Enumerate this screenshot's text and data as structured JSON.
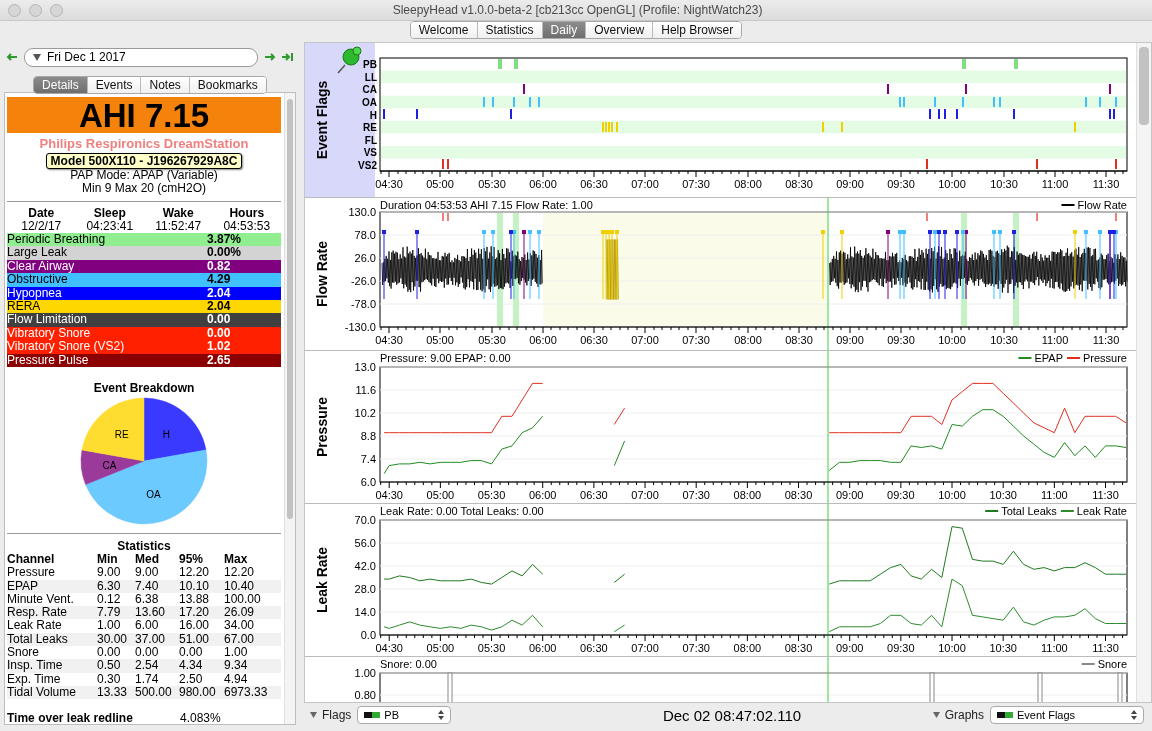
{
  "window": {
    "title": "SleepyHead v1.0.0-beta-2 [cb213cc OpenGL] (Profile: NightWatch23)"
  },
  "tabs": [
    {
      "label": "Welcome",
      "selected": false
    },
    {
      "label": "Statistics",
      "selected": false
    },
    {
      "label": "Daily",
      "selected": true
    },
    {
      "label": "Overview",
      "selected": false
    },
    {
      "label": "Help Browser",
      "selected": false
    }
  ],
  "date_nav": {
    "date": "Fri Dec 1 2017"
  },
  "side_tabs": [
    {
      "label": "Details",
      "selected": true
    },
    {
      "label": "Events",
      "selected": false
    },
    {
      "label": "Notes",
      "selected": false
    },
    {
      "label": "Bookmarks",
      "selected": false
    }
  ],
  "summary": {
    "ahi": "AHI 7.15",
    "machine": "Philips Respironics DreamStation",
    "tooltip": "Model 500X110 - J196267929A8C",
    "mode": "PAP Mode: APAP (Variable)",
    "pressure_range": "Min 9 Max 20 (cmH2O)"
  },
  "session": {
    "columns": [
      "Date",
      "Sleep",
      "Wake",
      "Hours"
    ],
    "values": [
      "12/2/17",
      "04:23:41",
      "11:52:47",
      "04:53:53"
    ]
  },
  "event_indices": [
    {
      "name": "Periodic Breathing",
      "value": "3.87%",
      "color": "#90ee90"
    },
    {
      "name": "Large Leak",
      "value": "0.00%",
      "color": "#d3d3d3"
    },
    {
      "name": "Clear Airway",
      "value": "0.82",
      "color": "#800080"
    },
    {
      "name": "Obstructive",
      "value": "4.29",
      "color": "#40c0ff"
    },
    {
      "name": "Hypopnea",
      "value": "2.04",
      "color": "#0000ff"
    },
    {
      "name": "RERA",
      "value": "2.04",
      "color": "#ffd700"
    },
    {
      "name": "Flow Limitation",
      "value": "0.00",
      "color": "#404040"
    },
    {
      "name": "Vibratory Snore",
      "value": "0.00",
      "color": "#ff2000"
    },
    {
      "name": "Vibratory Snore (VS2)",
      "value": "1.02",
      "color": "#ff2000"
    },
    {
      "name": "Pressure Pulse",
      "value": "2.65",
      "color": "#8b0000"
    }
  ],
  "event_breakdown": {
    "chart_data": {
      "type": "pie",
      "title": "Event Breakdown",
      "categories": [
        "H",
        "OA",
        "CA",
        "RE"
      ],
      "values": [
        22.2,
        46.7,
        8.9,
        22.2
      ],
      "colors": [
        "#3a3aff",
        "#6ccaff",
        "#9a3a9a",
        "#ffdc30"
      ]
    }
  },
  "statistics": {
    "title": "Statistics",
    "columns": [
      "Channel",
      "Min",
      "Med",
      "95%",
      "Max"
    ],
    "rows": [
      [
        "Pressure",
        "9.00",
        "9.00",
        "12.20",
        "12.20"
      ],
      [
        "EPAP",
        "6.30",
        "7.40",
        "10.10",
        "10.40"
      ],
      [
        "Minute Vent.",
        "0.12",
        "6.38",
        "13.88",
        "100.00"
      ],
      [
        "Resp. Rate",
        "7.79",
        "13.60",
        "17.20",
        "26.09"
      ],
      [
        "Leak Rate",
        "1.00",
        "6.00",
        "16.00",
        "34.00"
      ],
      [
        "Total Leaks",
        "30.00",
        "37.00",
        "51.00",
        "67.00"
      ],
      [
        "Snore",
        "0.00",
        "0.00",
        "0.00",
        "1.00"
      ],
      [
        "Insp. Time",
        "0.50",
        "2.54",
        "4.34",
        "9.34"
      ],
      [
        "Exp. Time",
        "0.30",
        "1.74",
        "2.50",
        "4.94"
      ],
      [
        "Tidal Volume",
        "13.33",
        "500.00",
        "980.00",
        "6973.33"
      ]
    ]
  },
  "leak_redline": {
    "label": "Time over leak redline",
    "value": "4.083%"
  },
  "graphs": [
    {
      "kind": "flags",
      "ylabel": "Event Flags",
      "rows": [
        {
          "label": "PB",
          "color": "#80e080"
        },
        {
          "label": "LL"
        },
        {
          "label": "CA",
          "color": "#800080"
        },
        {
          "label": "OA",
          "color": "#40c0ff"
        },
        {
          "label": "H",
          "color": "#2020e0"
        },
        {
          "label": "RE",
          "color": "#f0d000"
        },
        {
          "label": "FL"
        },
        {
          "label": "VS"
        },
        {
          "label": "VS2",
          "color": "#e03020"
        }
      ],
      "xticks": [
        "04:30",
        "05:00",
        "05:30",
        "06:00",
        "06:30",
        "07:00",
        "07:30",
        "08:00",
        "08:30",
        "09:00",
        "09:30",
        "10:00",
        "10:30",
        "11:00",
        "11:30"
      ]
    },
    {
      "kind": "wave",
      "ylabel": "Flow Rate",
      "header": "Duration 04:53:53 AHI 7.15 Flow Rate: 1.00",
      "legend": [
        {
          "name": "Flow Rate",
          "color": "#000000"
        }
      ],
      "yticks": [
        "130.0",
        "78.0",
        "26.0",
        "-26.0",
        "-78.0",
        "-130.0"
      ],
      "xticks": [
        "04:30",
        "05:00",
        "05:30",
        "06:00",
        "06:30",
        "07:00",
        "07:30",
        "08:00",
        "08:30",
        "09:00",
        "09:30",
        "10:00",
        "10:30",
        "11:00",
        "11:30"
      ]
    },
    {
      "kind": "line",
      "header": "Pressure: 9.00 EPAP: 0.00",
      "chart_data": {
        "type": "line",
        "ylabel": "Pressure",
        "grid": true,
        "legend": "upper right",
        "xlim": [
          4.41,
          11.71
        ],
        "ylim": [
          6,
          13
        ],
        "ref_lines": [
          {
            "axis": "x",
            "value": 8.784,
            "color": "#3fd03f"
          }
        ],
        "xticks": [
          {
            "value": 4.5,
            "label": "04:30"
          },
          {
            "value": 5,
            "label": "05:00"
          },
          {
            "value": 5.5,
            "label": "05:30"
          },
          {
            "value": 6,
            "label": "06:00"
          },
          {
            "value": 6.5,
            "label": "06:30"
          },
          {
            "value": 7,
            "label": "07:00"
          },
          {
            "value": 7.5,
            "label": "07:30"
          },
          {
            "value": 8,
            "label": "08:00"
          },
          {
            "value": 8.5,
            "label": "08:30"
          },
          {
            "value": 9,
            "label": "09:00"
          },
          {
            "value": 9.5,
            "label": "09:30"
          },
          {
            "value": 10,
            "label": "10:00"
          },
          {
            "value": 10.5,
            "label": "10:30"
          },
          {
            "value": 11,
            "label": "11:00"
          },
          {
            "value": 11.5,
            "label": "11:30"
          }
        ],
        "yticks": [
          {
            "value": 6,
            "label": "6.0"
          },
          {
            "value": 7.4,
            "label": "7.4"
          },
          {
            "value": 8.8,
            "label": "8.8"
          },
          {
            "value": 10.2,
            "label": "10.2"
          },
          {
            "value": 11.6,
            "label": "11.6"
          },
          {
            "value": 13,
            "label": "13.0"
          }
        ],
        "x": [
          4.45,
          4.5,
          4.6,
          4.7,
          4.8,
          4.9,
          5.0,
          5.1,
          5.2,
          5.3,
          5.4,
          5.5,
          5.6,
          5.7,
          5.8,
          5.9,
          6.0,
          6.7,
          6.8,
          8.8,
          8.9,
          9.0,
          9.1,
          9.2,
          9.3,
          9.4,
          9.5,
          9.6,
          9.7,
          9.8,
          9.9,
          10.0,
          10.1,
          10.2,
          10.3,
          10.4,
          10.5,
          10.6,
          10.7,
          10.8,
          10.9,
          11.0,
          11.1,
          11.2,
          11.3,
          11.4,
          11.5,
          11.6,
          11.7
        ],
        "series": [
          {
            "name": "EPAP",
            "color": "#228b22",
            "values": [
              6.5,
              7.0,
              7.1,
              7.1,
              7.2,
              7.1,
              7.2,
              7.2,
              7.2,
              7.3,
              7.3,
              7.1,
              8.0,
              8.2,
              9.0,
              9.3,
              10.0,
              7.0,
              8.5,
              6.7,
              7.2,
              7.2,
              7.3,
              7.3,
              7.3,
              7.2,
              7.2,
              8.2,
              8.1,
              8.2,
              8.0,
              9.5,
              9.4,
              10.0,
              10.4,
              10.4,
              10.0,
              9.4,
              8.8,
              8.3,
              7.8,
              7.5,
              8.4,
              7.6,
              8.2,
              7.5,
              8.2,
              8.2,
              8.1
            ]
          },
          {
            "name": "Pressure",
            "color": "#e03020",
            "values": [
              9,
              9,
              9,
              9,
              9,
              9,
              9,
              9,
              9,
              9,
              9,
              9,
              10,
              10,
              11,
              12,
              12,
              9.5,
              10.5,
              9,
              9,
              9,
              9,
              9,
              9,
              9,
              9,
              10,
              10,
              10,
              9.5,
              11,
              11.5,
              12,
              12,
              12,
              11.4,
              10.8,
              10.2,
              9.6,
              9.3,
              9,
              10.5,
              9,
              10,
              10,
              10,
              10,
              9.6
            ]
          }
        ]
      }
    },
    {
      "kind": "line",
      "header": "Leak Rate: 0.00 Total Leaks: 0.00",
      "chart_data": {
        "type": "line",
        "ylabel": "Leak Rate",
        "grid": true,
        "legend": "upper right",
        "xlim": [
          4.41,
          11.71
        ],
        "ylim": [
          0,
          70
        ],
        "ref_lines": [
          {
            "axis": "x",
            "value": 8.784,
            "color": "#3fd03f"
          }
        ],
        "xticks": [
          {
            "value": 4.5,
            "label": "04:30"
          },
          {
            "value": 5,
            "label": "05:00"
          },
          {
            "value": 5.5,
            "label": "05:30"
          },
          {
            "value": 6,
            "label": "06:00"
          },
          {
            "value": 6.5,
            "label": "06:30"
          },
          {
            "value": 7,
            "label": "07:00"
          },
          {
            "value": 7.5,
            "label": "07:30"
          },
          {
            "value": 8,
            "label": "08:00"
          },
          {
            "value": 8.5,
            "label": "08:30"
          },
          {
            "value": 9,
            "label": "09:00"
          },
          {
            "value": 9.5,
            "label": "09:30"
          },
          {
            "value": 10,
            "label": "10:00"
          },
          {
            "value": 10.5,
            "label": "10:30"
          },
          {
            "value": 11,
            "label": "11:00"
          },
          {
            "value": 11.5,
            "label": "11:30"
          }
        ],
        "yticks": [
          {
            "value": 0,
            "label": "0.0"
          },
          {
            "value": 14,
            "label": "14.0"
          },
          {
            "value": 28,
            "label": "28.0"
          },
          {
            "value": 42,
            "label": "42.0"
          },
          {
            "value": 56,
            "label": "56.0"
          },
          {
            "value": 70,
            "label": "70.0"
          }
        ],
        "x": [
          4.45,
          4.5,
          4.6,
          4.7,
          4.8,
          4.9,
          5.0,
          5.1,
          5.2,
          5.3,
          5.4,
          5.5,
          5.6,
          5.7,
          5.8,
          5.9,
          6.0,
          6.7,
          6.8,
          8.8,
          8.9,
          9.0,
          9.1,
          9.2,
          9.3,
          9.4,
          9.5,
          9.6,
          9.7,
          9.8,
          9.9,
          10.0,
          10.1,
          10.2,
          10.3,
          10.4,
          10.5,
          10.6,
          10.7,
          10.8,
          10.9,
          11.0,
          11.1,
          11.2,
          11.3,
          11.4,
          11.5,
          11.6,
          11.7
        ],
        "series": [
          {
            "name": "Total Leaks",
            "color": "#1e7a1e",
            "values": [
              34,
              34,
              36,
              35,
              33,
              34,
              33,
              33,
              33,
              34,
              32,
              31,
              35,
              39,
              36,
              43,
              37,
              32,
              37,
              31,
              33,
              33,
              33,
              33,
              37,
              41,
              43,
              36,
              34,
              40,
              35,
              66,
              65,
              46,
              45,
              45,
              43,
              51,
              43,
              40,
              41,
              39,
              41,
              41,
              44,
              41,
              37,
              37,
              37
            ]
          },
          {
            "name": "Leak Rate",
            "color": "#2e8b2e",
            "values": [
              5,
              4,
              6,
              8,
              6,
              5,
              4,
              5,
              4,
              6,
              5,
              3,
              5,
              9,
              6,
              12,
              5,
              2,
              6,
              2,
              5,
              5,
              5,
              5,
              7,
              12,
              12,
              7,
              6,
              12,
              5,
              34,
              30,
              12,
              11,
              10,
              9,
              17,
              8,
              6,
              9,
              11,
              11,
              12,
              16,
              10,
              7,
              7,
              7
            ]
          }
        ]
      }
    },
    {
      "kind": "snore",
      "header": "Snore: 0.00",
      "legend": [
        {
          "name": "Snore",
          "color": "#888888"
        }
      ],
      "yticks": [
        "1.00",
        "0.80"
      ]
    }
  ],
  "bottom_bar": {
    "flags_label": "Flags",
    "flags_value": "PB",
    "time": "Dec 02 08:47:02.110",
    "graphs_label": "Graphs",
    "graphs_value": "Event Flags"
  }
}
